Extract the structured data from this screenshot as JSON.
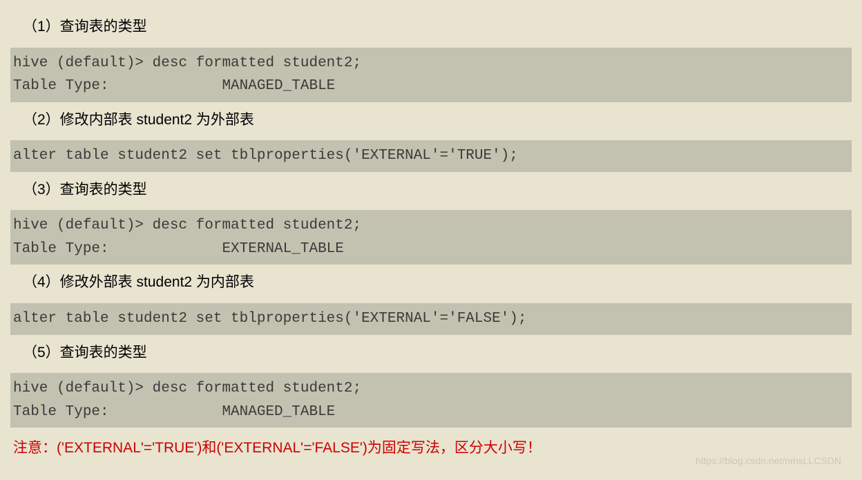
{
  "steps": [
    {
      "label": "（1）查询表的类型",
      "code": "hive (default)> desc formatted student2;\nTable Type:             MANAGED_TABLE"
    },
    {
      "label": "（2）修改内部表 student2 为外部表",
      "code": "alter table student2 set tblproperties('EXTERNAL'='TRUE');"
    },
    {
      "label": "（3）查询表的类型",
      "code": "hive (default)> desc formatted student2;\nTable Type:             EXTERNAL_TABLE"
    },
    {
      "label": "（4）修改外部表 student2 为内部表",
      "code": "alter table student2 set tblproperties('EXTERNAL'='FALSE');"
    },
    {
      "label": "（5）查询表的类型",
      "code": "hive (default)> desc formatted student2;\nTable Type:             MANAGED_TABLE"
    }
  ],
  "note": "注意：('EXTERNAL'='TRUE')和('EXTERNAL'='FALSE')为固定写法，区分大小写！",
  "watermark": "https://blog.csdn.net/nmsLLCSDN"
}
